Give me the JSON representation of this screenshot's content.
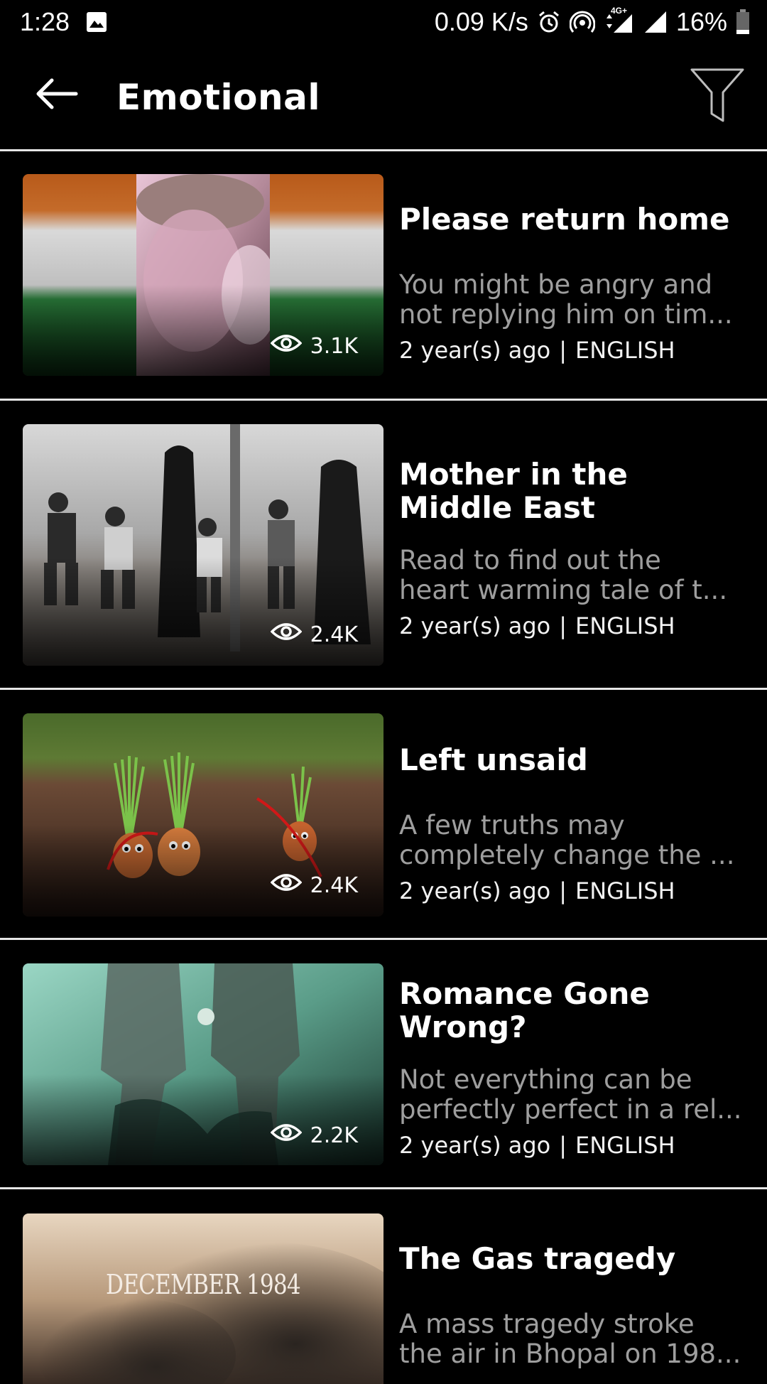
{
  "status_bar": {
    "time": "1:28",
    "network_speed": "0.09 K/s",
    "network_type": "4G+",
    "battery": "16%",
    "icons": [
      "image-icon",
      "alarm-icon",
      "hotspot-icon",
      "signal-icon",
      "battery-icon"
    ]
  },
  "header": {
    "title": "Emotional",
    "back_icon": "arrow-left-icon",
    "filter_icon": "filter-icon"
  },
  "stories": [
    {
      "title": "Please return home",
      "description_lines": [
        "You might be angry and",
        "not replying him on tim..."
      ],
      "views": "3.1K",
      "age": "2 year(s) ago",
      "separator": "|",
      "language": "ENGLISH"
    },
    {
      "title": "Mother in the Middle East",
      "description_lines": [
        "Read to find out the",
        "heart warming tale of t..."
      ],
      "views": "2.4K",
      "age": "2 year(s) ago",
      "separator": "|",
      "language": "ENGLISH"
    },
    {
      "title": "Left unsaid",
      "description_lines": [
        "A few truths may",
        "completely change the ..."
      ],
      "views": "2.4K",
      "age": "2 year(s) ago",
      "separator": "|",
      "language": "ENGLISH"
    },
    {
      "title": "Romance Gone Wrong?",
      "description_lines": [
        "Not everything can be",
        "perfectly perfect in a rel..."
      ],
      "views": "2.2K",
      "age": "2 year(s) ago",
      "separator": "|",
      "language": "ENGLISH"
    },
    {
      "title": "The Gas tragedy",
      "description_lines": [
        "A mass tragedy stroke",
        "the air in Bhopal on 198..."
      ],
      "thumbnail_text": "DECEMBER 1984"
    }
  ],
  "colors": {
    "background": "#000000",
    "divider": "#e6e6e6",
    "description_text": "#9e9e9e"
  }
}
